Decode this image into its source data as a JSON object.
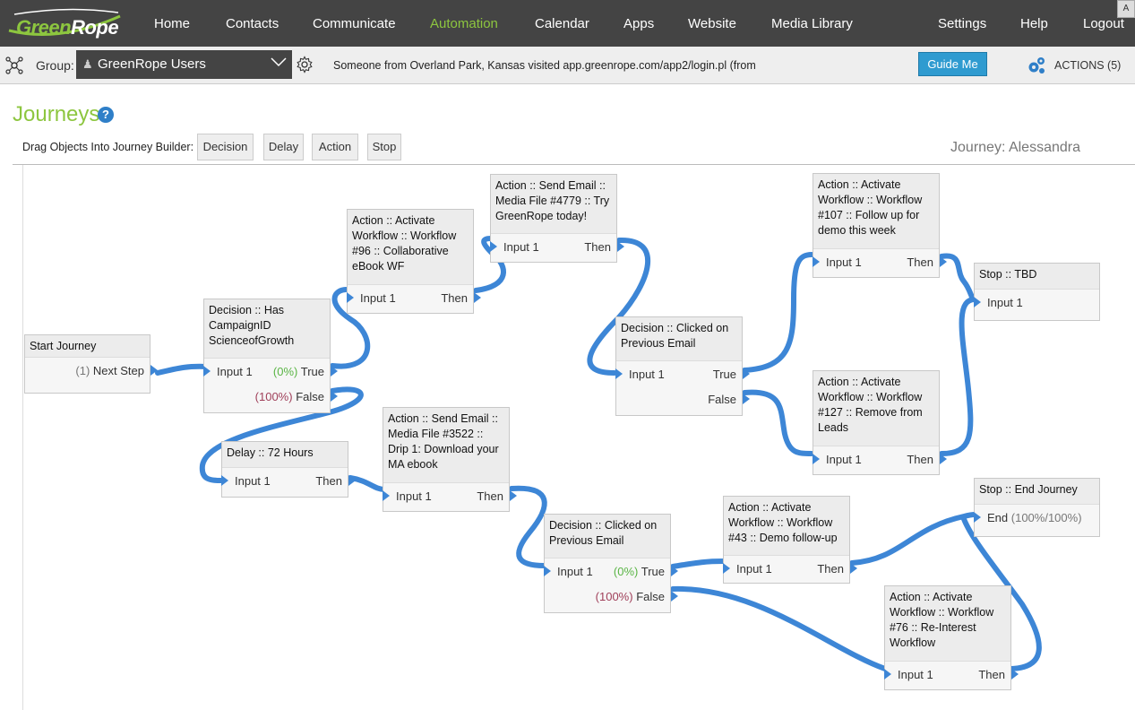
{
  "nav": {
    "logo_green": "Green",
    "logo_rope": "Rope",
    "items": [
      {
        "label": "Home"
      },
      {
        "label": "Contacts"
      },
      {
        "label": "Communicate"
      },
      {
        "label": "Automation",
        "active": true
      },
      {
        "label": "Calendar"
      },
      {
        "label": "Apps"
      },
      {
        "label": "Website"
      },
      {
        "label": "Media Library"
      },
      {
        "label": "Settings"
      },
      {
        "label": "Help"
      },
      {
        "label": "Logout"
      }
    ]
  },
  "subbar": {
    "group_label": "Group:",
    "group_value": "GreenRope Users",
    "activity": "Someone from Overland Park, Kansas visited app.greenrope.com/app2/login.pl (from",
    "guide_button": "Guide Me",
    "actions_label": "ACTIONS (5)"
  },
  "page": {
    "title": "Journeys",
    "help": "?",
    "drag_label": "Drag Objects Into Journey Builder:",
    "tools": [
      "Decision",
      "Delay",
      "Action",
      "Stop"
    ],
    "journey_name": "Journey: Alessandra"
  },
  "colors": {
    "brand_green": "#8dc63f",
    "nav_bg": "#444444",
    "wire_blue": "#3d86d6",
    "guide_blue": "#2f9bd0"
  },
  "nodes": {
    "start": {
      "title": "Start Journey",
      "out_pct": "(1)",
      "out_label": "Next Step"
    },
    "decision1": {
      "title": "Decision :: Has CampaignID ScienceofGrowth",
      "input": "Input 1",
      "true_pct": "(0%)",
      "true_label": "True",
      "false_pct": "(100%)",
      "false_label": "False"
    },
    "action96": {
      "title": "Action :: Activate Workflow :: Workflow #96 :: Collaborative eBook WF",
      "input": "Input 1",
      "out_label": "Then"
    },
    "email4779": {
      "title": "Action :: Send Email :: Media File #4779 :: Try GreenRope today!",
      "input": "Input 1",
      "out_label": "Then"
    },
    "decision2": {
      "title": "Decision :: Clicked on Previous Email",
      "input": "Input 1",
      "true_label": "True",
      "false_label": "False"
    },
    "action107": {
      "title": "Action :: Activate Workflow :: Workflow #107 :: Follow up for demo this week",
      "input": "Input 1",
      "out_label": "Then"
    },
    "action127": {
      "title": "Action :: Activate Workflow :: Workflow #127 :: Remove from Leads",
      "input": "Input 1",
      "out_label": "Then"
    },
    "stop_tbd": {
      "title": "Stop :: TBD",
      "input": "Input 1"
    },
    "delay72": {
      "title": "Delay :: 72 Hours",
      "input": "Input 1",
      "out_label": "Then"
    },
    "email3522": {
      "title": "Action :: Send Email :: Media File #3522 :: Drip 1: Download your MA ebook",
      "input": "Input 1",
      "out_label": "Then"
    },
    "decision3": {
      "title": "Decision :: Clicked on Previous Email",
      "input": "Input 1",
      "true_pct": "(0%)",
      "true_label": "True",
      "false_pct": "(100%)",
      "false_label": "False"
    },
    "action43": {
      "title": "Action :: Activate Workflow :: Workflow #43 :: Demo follow-up",
      "input": "Input 1",
      "out_label": "Then"
    },
    "stop_end": {
      "title": "Stop :: End Journey",
      "end_label": "End",
      "end_pct": "(100%/100%)"
    },
    "action76": {
      "title": "Action :: Activate Workflow :: Workflow #76 :: Re-Interest Workflow",
      "input": "Input 1",
      "out_label": "Then"
    }
  }
}
